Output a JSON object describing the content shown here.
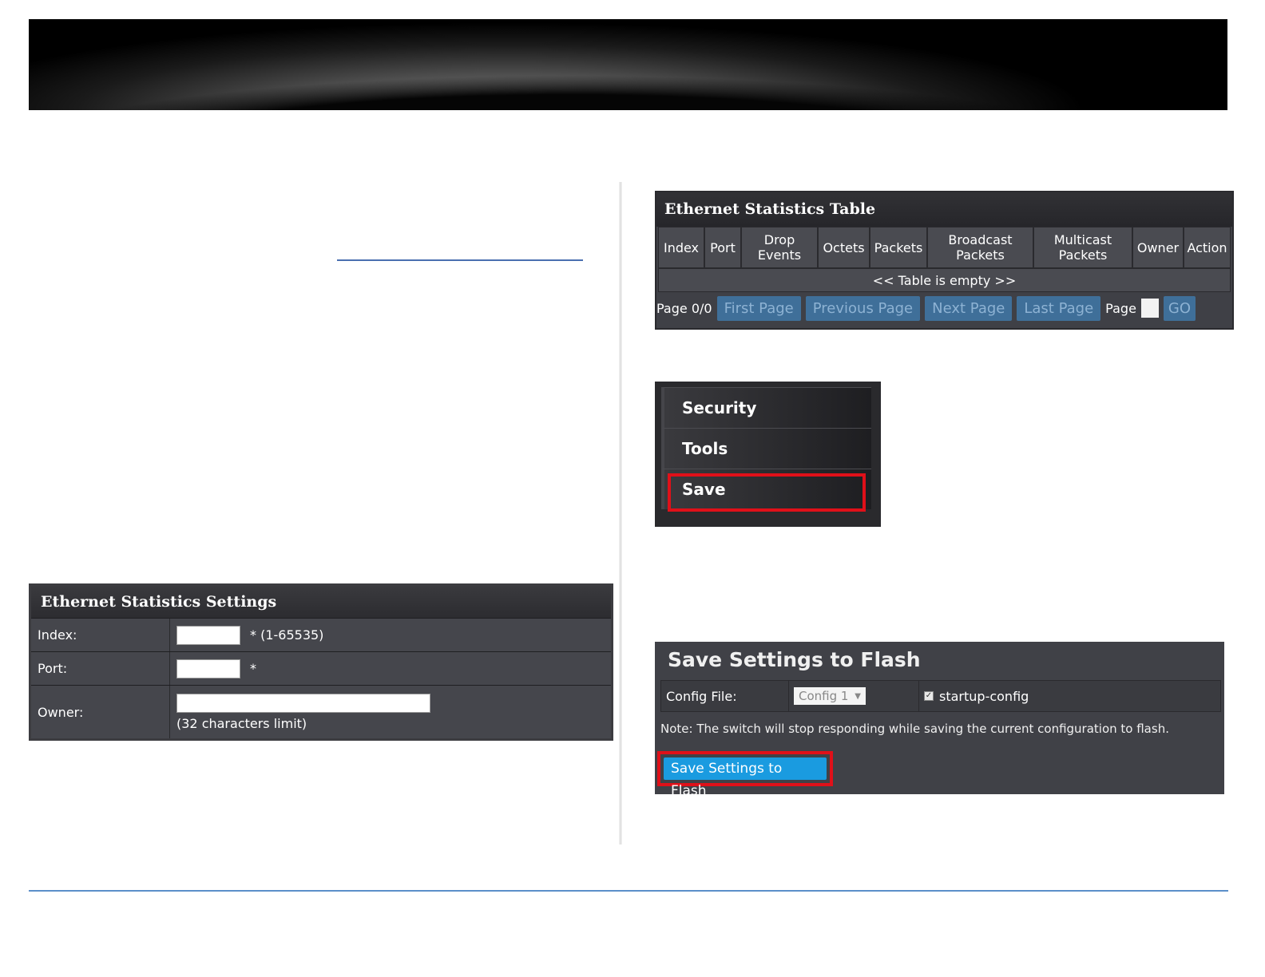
{
  "settings_panel": {
    "title": "Ethernet Statistics Settings",
    "index_label": "Index:",
    "index_hint": "* (1-65535)",
    "port_label": "Port:",
    "port_hint": "*",
    "owner_label": "Owner:",
    "owner_hint": "(32 characters limit)"
  },
  "stats_table": {
    "title": "Ethernet Statistics Table",
    "columns": [
      "Index",
      "Port",
      "Drop Events",
      "Octets",
      "Packets",
      "Broadcast Packets",
      "Multicast Packets",
      "Owner",
      "Action"
    ],
    "empty_message": "<< Table is empty >>",
    "pager": {
      "page_status": "Page 0/0",
      "first": "First Page",
      "previous": "Previous Page",
      "next": "Next Page",
      "last": "Last Page",
      "page_label": "Page",
      "go": "GO"
    }
  },
  "menu": {
    "items": [
      "Security",
      "Tools",
      "Save"
    ]
  },
  "flash_panel": {
    "title": "Save Settings to Flash",
    "config_label": "Config File:",
    "config_selected": "Config 1",
    "startup_label": "startup-config",
    "startup_checked": true,
    "note": "Note: The switch will stop responding while saving the current configuration to flash.",
    "save_button": "Save Settings to Flash"
  }
}
